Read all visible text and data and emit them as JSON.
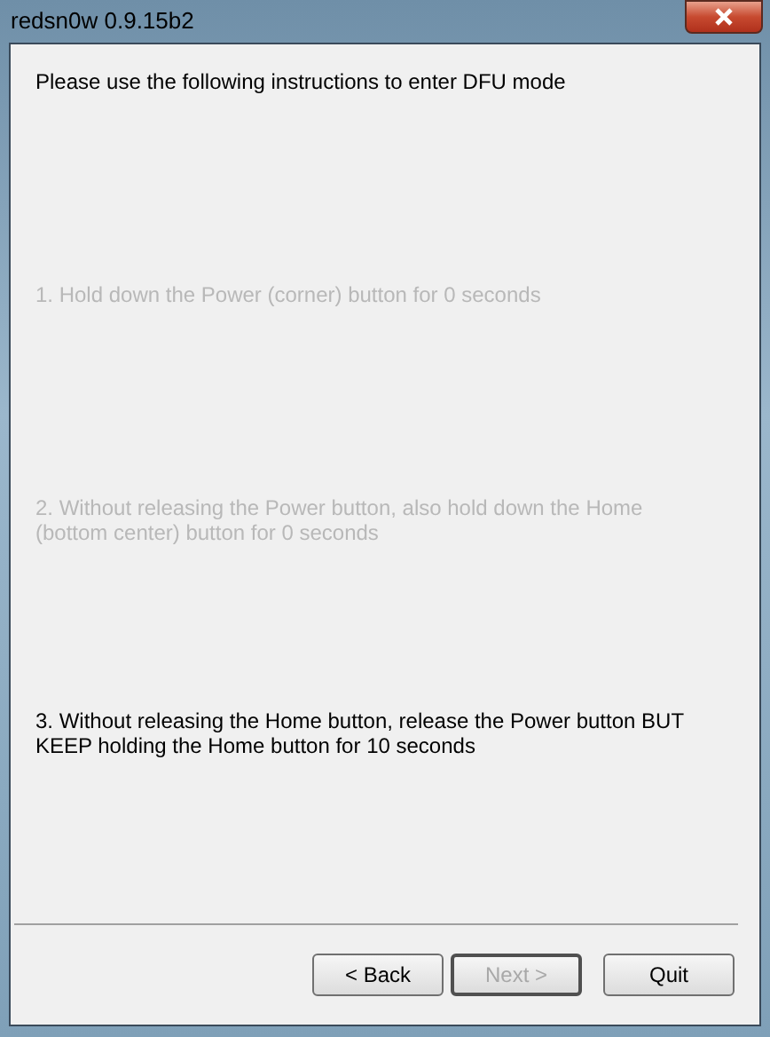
{
  "window": {
    "title": "redsn0w 0.9.15b2"
  },
  "intro": "Please use the following instructions to enter DFU mode",
  "steps": [
    {
      "text": "1. Hold down the Power (corner) button for 0 seconds",
      "disabled": true
    },
    {
      "text": "2. Without releasing the Power button, also hold down the Home (bottom center) button for 0 seconds",
      "disabled": true
    },
    {
      "text": "3. Without releasing the Home button, release the Power button BUT KEEP holding the Home button for 10 seconds",
      "disabled": false
    }
  ],
  "buttons": [
    {
      "label": "< Back",
      "disabled": false,
      "default": false
    },
    {
      "label": "Next >",
      "disabled": true,
      "default": true
    },
    {
      "label": "Quit",
      "disabled": false,
      "default": false
    }
  ]
}
